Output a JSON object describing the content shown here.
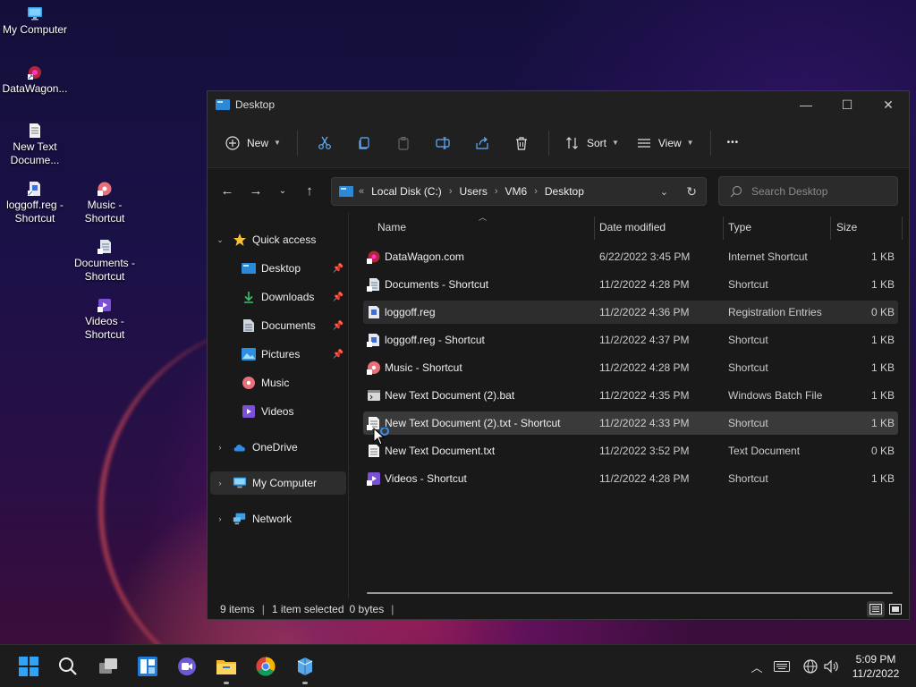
{
  "desktop": {
    "icons": [
      {
        "label": "My Computer",
        "icon": "monitor-icon"
      },
      {
        "label": "DataWagon...",
        "icon": "internet-shortcut-icon"
      },
      {
        "label": "New Text Docume...",
        "icon": "text-document-icon"
      },
      {
        "label": "loggoff.reg - Shortcut",
        "icon": "registry-shortcut-icon"
      },
      {
        "label": "Music - Shortcut",
        "icon": "music-icon"
      },
      {
        "label": "Documents - Shortcut",
        "icon": "documents-icon"
      },
      {
        "label": "Videos - Shortcut",
        "icon": "videos-icon"
      }
    ]
  },
  "window": {
    "title": "Desktop",
    "controls": {
      "minimize": "—",
      "maximize": "☐",
      "close": "✕"
    }
  },
  "toolbar": {
    "new_label": "New",
    "sort_label": "Sort",
    "view_label": "View",
    "more_label": "•••"
  },
  "address": {
    "crumbs": [
      "Local Disk (C:)",
      "Users",
      "VM6",
      "Desktop"
    ],
    "search_placeholder": "Search Desktop"
  },
  "navpane": {
    "quick_access": "Quick access",
    "items": [
      {
        "label": "Desktop",
        "icon": "desktop-icon",
        "pinned": true
      },
      {
        "label": "Downloads",
        "icon": "download-icon",
        "pinned": true
      },
      {
        "label": "Documents",
        "icon": "documents-icon",
        "pinned": true
      },
      {
        "label": "Pictures",
        "icon": "pictures-icon",
        "pinned": true
      },
      {
        "label": "Music",
        "icon": "music-icon",
        "pinned": false
      },
      {
        "label": "Videos",
        "icon": "videos-icon",
        "pinned": false
      }
    ],
    "onedrive": "OneDrive",
    "my_computer": "My Computer",
    "network": "Network"
  },
  "filelist": {
    "columns": {
      "name": "Name",
      "date": "Date modified",
      "type": "Type",
      "size": "Size"
    },
    "rows": [
      {
        "name": "DataWagon.com",
        "date": "6/22/2022 3:45 PM",
        "type": "Internet Shortcut",
        "size": "1 KB",
        "icon": "internet-shortcut-icon"
      },
      {
        "name": "Documents - Shortcut",
        "date": "11/2/2022 4:28 PM",
        "type": "Shortcut",
        "size": "1 KB",
        "icon": "documents-icon"
      },
      {
        "name": "loggoff.reg",
        "date": "11/2/2022 4:36 PM",
        "type": "Registration Entries",
        "size": "0 KB",
        "icon": "registry-icon"
      },
      {
        "name": "loggoff.reg - Shortcut",
        "date": "11/2/2022 4:37 PM",
        "type": "Shortcut",
        "size": "1 KB",
        "icon": "registry-shortcut-icon"
      },
      {
        "name": "Music - Shortcut",
        "date": "11/2/2022 4:28 PM",
        "type": "Shortcut",
        "size": "1 KB",
        "icon": "music-icon"
      },
      {
        "name": "New Text Document (2).bat",
        "date": "11/2/2022 4:35 PM",
        "type": "Windows Batch File",
        "size": "1 KB",
        "icon": "batch-file-icon"
      },
      {
        "name": "New Text Document (2).txt - Shortcut",
        "date": "11/2/2022 4:33 PM",
        "type": "Shortcut",
        "size": "1 KB",
        "icon": "text-document-icon"
      },
      {
        "name": "New Text Document.txt",
        "date": "11/2/2022 3:52 PM",
        "type": "Text Document",
        "size": "0 KB",
        "icon": "text-document-icon"
      },
      {
        "name": "Videos - Shortcut",
        "date": "11/2/2022 4:28 PM",
        "type": "Shortcut",
        "size": "1 KB",
        "icon": "videos-icon"
      }
    ]
  },
  "status": {
    "items": "9 items",
    "selected": "1 item selected",
    "bytes": "0 bytes"
  },
  "taskbar": {
    "clock_time": "5:09 PM",
    "clock_date": "11/2/2022"
  },
  "colors": {
    "accent": "#0078d4",
    "window_bg": "#191919",
    "taskbar_bg": "#1c1c1c"
  }
}
